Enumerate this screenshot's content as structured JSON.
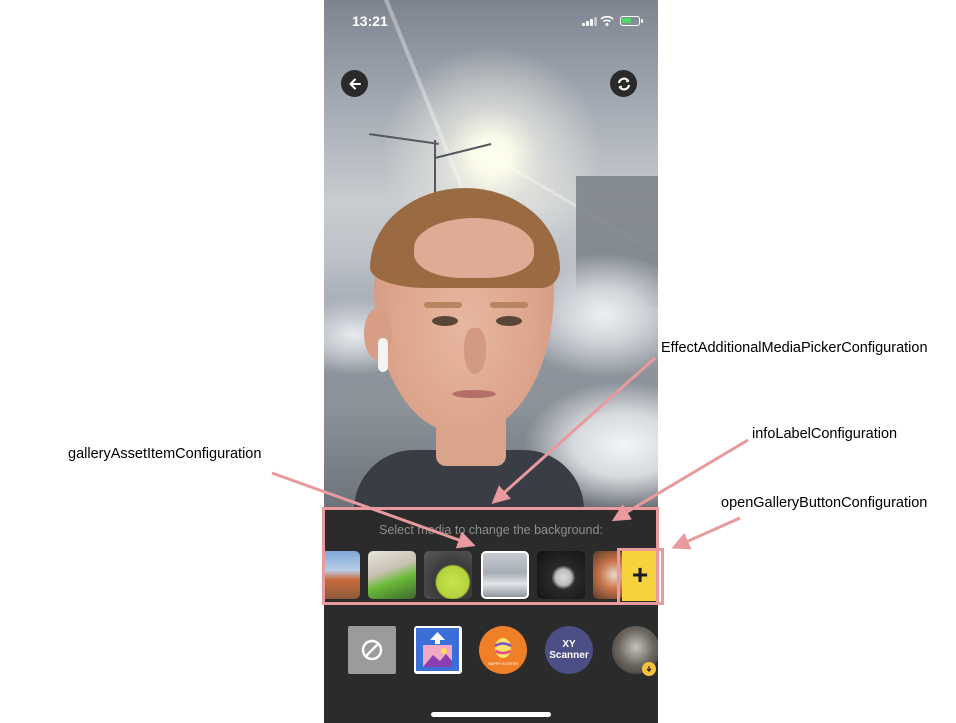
{
  "status_bar": {
    "time": "13:21"
  },
  "top_controls": {
    "back_icon": "arrow-left-icon",
    "switch_camera_icon": "camera-switch-icon"
  },
  "media_picker": {
    "info_label": "Select media to change the background:",
    "gallery_items": [
      {
        "name": "gallery-thumb-city",
        "selected": false
      },
      {
        "name": "gallery-thumb-plant-tray",
        "selected": false
      },
      {
        "name": "gallery-thumb-green-bowl",
        "selected": false
      },
      {
        "name": "gallery-thumb-winter-trees",
        "selected": true
      },
      {
        "name": "gallery-thumb-sink",
        "selected": false
      },
      {
        "name": "gallery-thumb-food",
        "selected": false
      }
    ],
    "open_gallery_label": "+"
  },
  "effects": {
    "items": [
      {
        "name": "effect-none",
        "icon": "no-effect-icon"
      },
      {
        "name": "effect-background",
        "icon": "image-upload-icon"
      },
      {
        "name": "effect-easter-egg",
        "label": "Happy Easter"
      },
      {
        "name": "effect-xy-scanner",
        "label": "XY\nScanner"
      },
      {
        "name": "effect-face-mask",
        "icon": "download-badge-icon"
      }
    ],
    "xy_line1": "XY",
    "xy_line2": "Scanner",
    "egg_label": "HAPPY EASTER"
  },
  "annotations": {
    "effect_picker": "EffectAdditionalMediaPickerConfiguration",
    "info_label": "infoLabelConfiguration",
    "gallery_asset_item": "galleryAssetItemConfiguration",
    "open_gallery_button": "openGalleryButtonConfiguration"
  },
  "colors": {
    "annotation": "#e89a9c",
    "open_gallery": "#f6d33e",
    "panel": "#2b2b2b",
    "info_label": "#8e8e8e"
  }
}
